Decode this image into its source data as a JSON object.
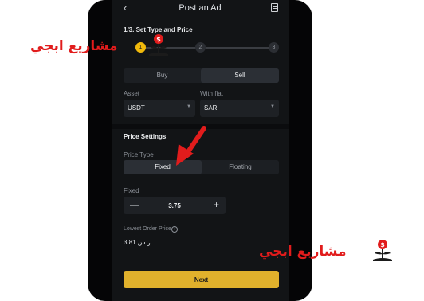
{
  "header": {
    "title": "Post an Ad",
    "back_icon": "chevron-left-icon",
    "doc_icon": "document-icon"
  },
  "steps": {
    "label": "1/3. Set Type and Price",
    "items": [
      "1",
      "2",
      "3"
    ]
  },
  "side_toggle": {
    "buy": "Buy",
    "sell": "Sell",
    "selected": "Sell"
  },
  "asset": {
    "label": "Asset",
    "value": "USDT"
  },
  "fiat": {
    "label": "With fiat",
    "value": "SAR"
  },
  "price_settings": {
    "title": "Price Settings",
    "price_type_label": "Price Type",
    "fixed": "Fixed",
    "floating": "Floating",
    "selected": "Fixed"
  },
  "fixed_price": {
    "label": "Fixed",
    "value": "3.75",
    "minus": "—",
    "plus": "+"
  },
  "lowest_order": {
    "label": "Lowest Order Price",
    "value": "3.81 ر.س"
  },
  "next_label": "Next",
  "watermark": {
    "text": "مشاريع ابجي",
    "logo_dollar": "$"
  },
  "colors": {
    "accent": "#f0b90b",
    "button": "#e0b12c",
    "arrow": "#e11c1c",
    "background": "#121416"
  }
}
